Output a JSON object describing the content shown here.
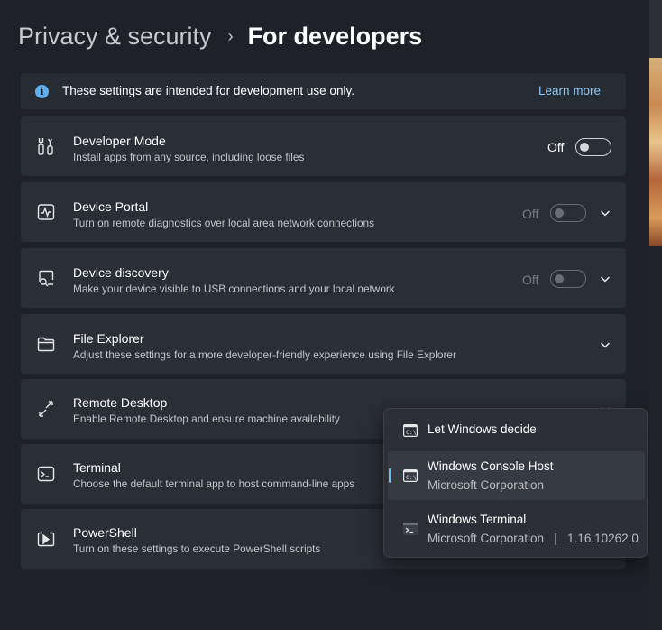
{
  "breadcrumb": {
    "parent": "Privacy & security",
    "separator": "›",
    "current": "For developers"
  },
  "info_bar": {
    "icon": "info-icon",
    "text": "These settings are intended for development use only.",
    "link": "Learn more"
  },
  "cards": [
    {
      "icon": "developer-tools-icon",
      "title": "Developer Mode",
      "subtitle": "Install apps from any source, including loose files",
      "toggle_label": "Off",
      "toggle_on": false,
      "toggle_enabled": true,
      "expandable": false
    },
    {
      "icon": "device-portal-icon",
      "title": "Device Portal",
      "subtitle": "Turn on remote diagnostics over local area network connections",
      "toggle_label": "Off",
      "toggle_on": false,
      "toggle_enabled": false,
      "expandable": true
    },
    {
      "icon": "device-discovery-icon",
      "title": "Device discovery",
      "subtitle": "Make your device visible to USB connections and your local network",
      "toggle_label": "Off",
      "toggle_on": false,
      "toggle_enabled": false,
      "expandable": true
    },
    {
      "icon": "file-explorer-icon",
      "title": "File Explorer",
      "subtitle": "Adjust these settings for a more developer-friendly experience using File Explorer",
      "expandable": true
    },
    {
      "icon": "remote-desktop-icon",
      "title": "Remote Desktop",
      "subtitle": "Enable Remote Desktop and ensure machine availability",
      "expandable": true
    },
    {
      "icon": "terminal-icon",
      "title": "Terminal",
      "subtitle": "Choose the default terminal app to host command-line apps"
    },
    {
      "icon": "powershell-icon",
      "title": "PowerShell",
      "subtitle": "Turn on these settings to execute PowerShell scripts"
    }
  ],
  "terminal_flyout": {
    "options": [
      {
        "icon": "console-icon",
        "title": "Let Windows decide",
        "subtitle": "",
        "selected": false
      },
      {
        "icon": "console-icon",
        "title": "Windows Console Host",
        "subtitle": "Microsoft Corporation",
        "selected": true
      },
      {
        "icon": "windows-terminal-icon",
        "title": "Windows Terminal",
        "subtitle": "Microsoft Corporation   |   1.16.10262.0",
        "selected": false
      }
    ]
  },
  "colors": {
    "accent": "#60b0f0",
    "link": "#8fc8f3",
    "card_bg": "#2a2e35",
    "page_bg": "#1e2228"
  }
}
